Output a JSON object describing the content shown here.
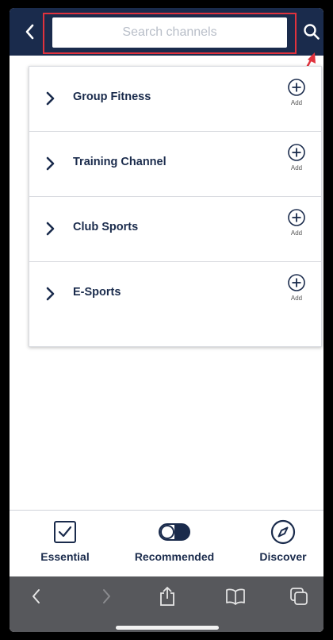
{
  "header": {
    "search_placeholder": "Search channels",
    "background_color": "#1a2b4c",
    "highlight_color": "#e0323d"
  },
  "channels": [
    {
      "label": "Group Fitness",
      "action": "Add"
    },
    {
      "label": "Training Channel",
      "action": "Add"
    },
    {
      "label": "Club Sports",
      "action": "Add"
    },
    {
      "label": "E-Sports",
      "action": "Add"
    }
  ],
  "tabbar": {
    "tabs": [
      {
        "label": "Essential",
        "icon": "checkbox-icon"
      },
      {
        "label": "Recommended",
        "icon": "toggle-icon"
      },
      {
        "label": "Discover",
        "icon": "compass-icon"
      }
    ]
  },
  "browser_toolbar": {
    "icons": [
      "back-icon",
      "forward-icon",
      "share-icon",
      "bookmarks-icon",
      "tabs-icon"
    ]
  }
}
